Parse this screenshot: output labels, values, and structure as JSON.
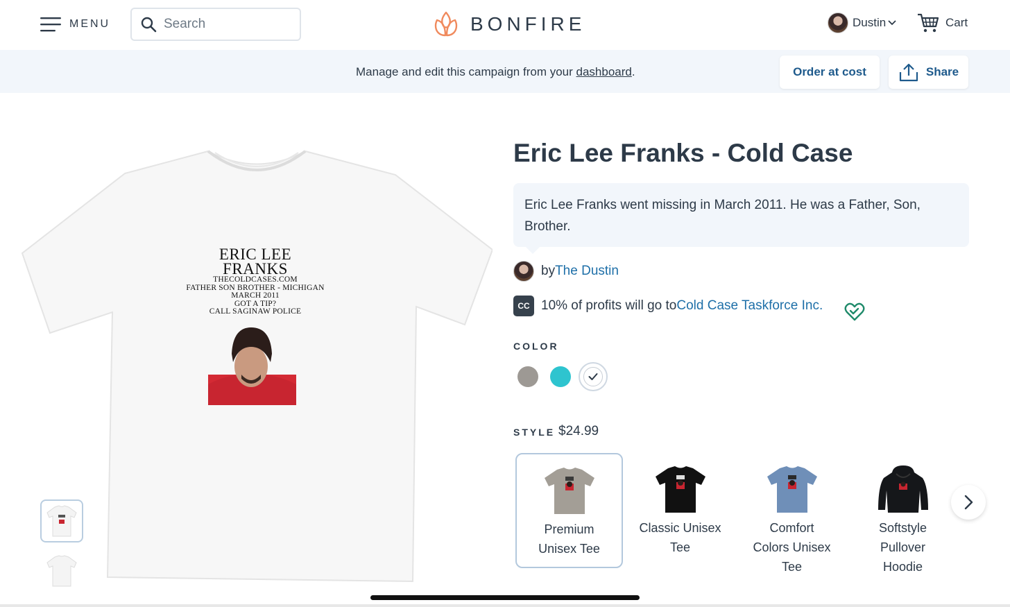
{
  "header": {
    "menu_label": "MENU",
    "search_placeholder": "Search",
    "brand": "BONFIRE",
    "user_name": "Dustin",
    "cart_label": "Cart"
  },
  "banner": {
    "text_before": "Manage and edit this campaign from your ",
    "link": "dashboard",
    "text_after": ".",
    "order_button": "Order at cost",
    "share_button": "Share"
  },
  "product_image": {
    "print_name_line1": "ERIC LEE",
    "print_name_line2": "FRANKS",
    "print_lines": [
      "THECOLDCASES.COM",
      "FATHER SON BROTHER - MICHIGAN",
      "MARCH 2011",
      "GOT A TIP?",
      "CALL SAGINAW POLICE"
    ]
  },
  "product": {
    "title": "Eric Lee Franks - Cold Case",
    "description": "Eric Lee Franks went missing in March 2011. He was a Father, Son, Brother.",
    "by_label": "by ",
    "creator": "The Dustin",
    "cause_badge": "CC",
    "cause_text": "10% of profits will go to ",
    "cause_name": "Cold Case Taskforce Inc."
  },
  "colors": {
    "label": "COLOR",
    "swatches": [
      {
        "name": "heather-grey",
        "hex": "#9d9994"
      },
      {
        "name": "turquoise",
        "hex": "#2ec4cf"
      },
      {
        "name": "white",
        "hex": "#ffffff",
        "selected": true
      }
    ]
  },
  "style": {
    "label": "STYLE",
    "price": "$24.99",
    "options": [
      {
        "name": "Premium Unisex Tee",
        "line1": "Premium",
        "line2": "Unisex Tee",
        "line3": "",
        "color": "#a39e96",
        "selected": true
      },
      {
        "name": "Classic Unisex Tee",
        "line1": "Classic Unisex",
        "line2": "Tee",
        "line3": "",
        "color": "#111111"
      },
      {
        "name": "Comfort Colors Unisex Tee",
        "line1": "Comfort",
        "line2": "Colors Unisex",
        "line3": "Tee",
        "color": "#6f8fb8"
      },
      {
        "name": "Softstyle Pullover Hoodie",
        "line1": "Softstyle",
        "line2": "Pullover",
        "line3": "Hoodie",
        "color": "#15171a"
      }
    ]
  },
  "theme": {
    "accent": "#1e6fa8",
    "button_text": "#1e5a8c",
    "banner_bg": "#f2f6fb",
    "brand_icon": "#f08a5d"
  }
}
